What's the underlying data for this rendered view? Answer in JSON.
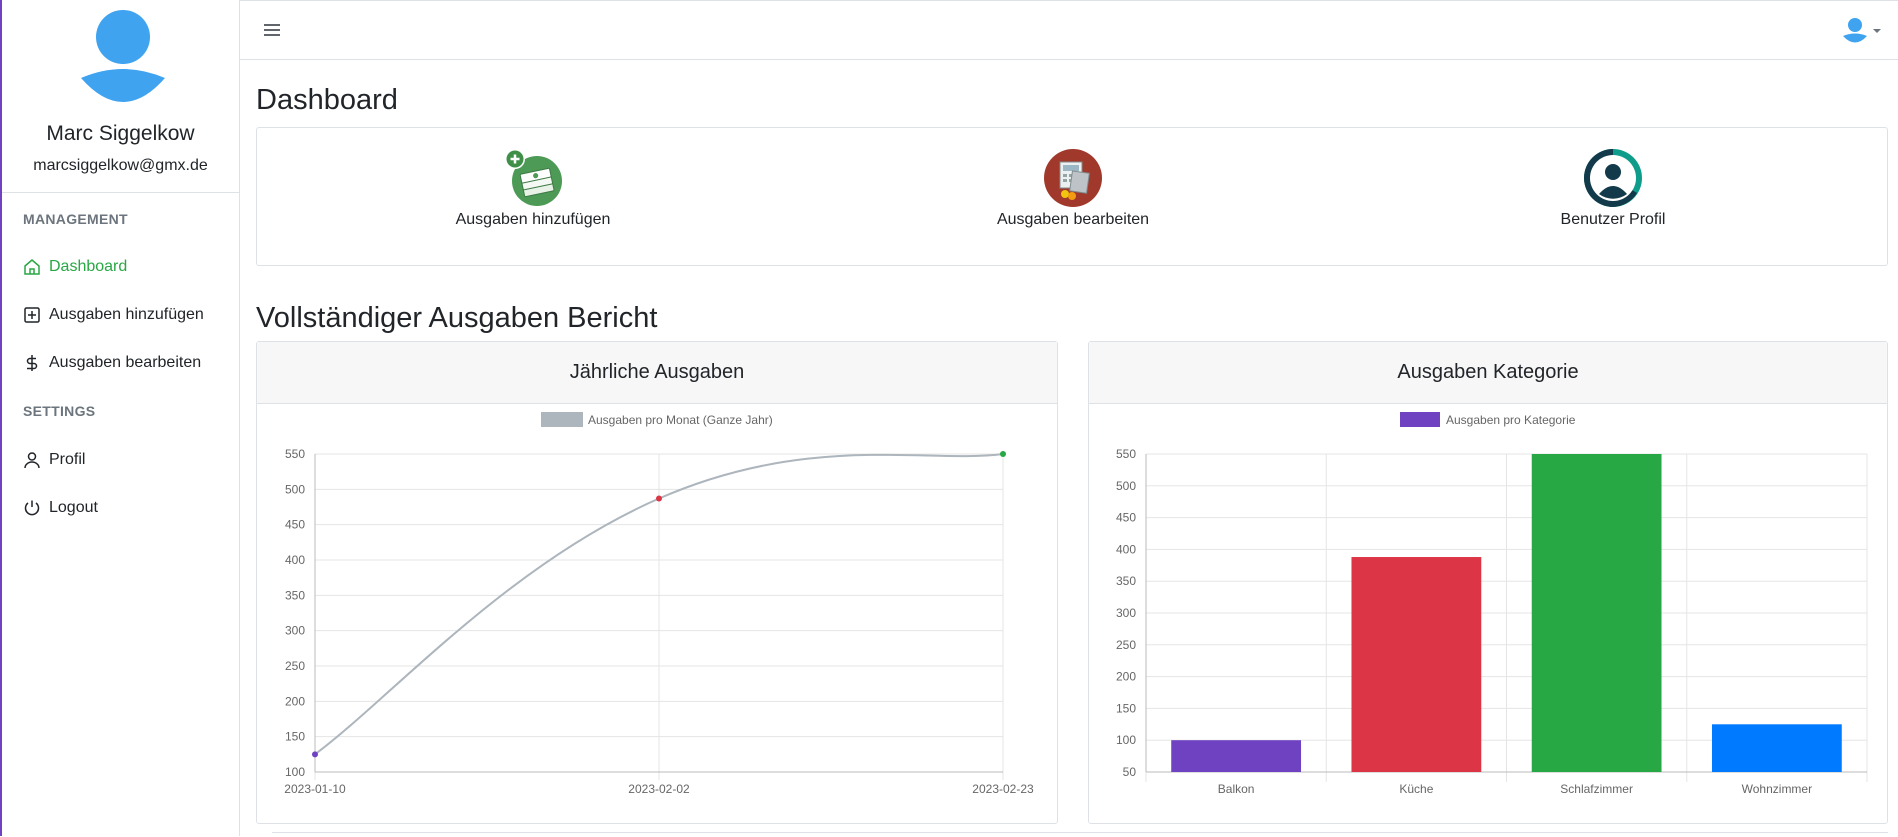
{
  "sidebar": {
    "user_name": "Marc Siggelkow",
    "user_email": "marcsiggelkow@gmx.de",
    "management_heading": "MANAGEMENT",
    "settings_heading": "SETTINGS",
    "items": [
      {
        "label": "Dashboard",
        "icon": "home-icon",
        "active": true
      },
      {
        "label": "Ausgaben hinzufügen",
        "icon": "plus-square-icon",
        "active": false
      },
      {
        "label": "Ausgaben bearbeiten",
        "icon": "dollar-icon",
        "active": false
      },
      {
        "label": "Profil",
        "icon": "user-icon",
        "active": false
      },
      {
        "label": "Logout",
        "icon": "power-icon",
        "active": false
      }
    ],
    "accent_color": "#28a745"
  },
  "header": {
    "menu_icon": "hamburger-icon",
    "user_icon": "user-avatar-icon"
  },
  "main": {
    "title": "Dashboard",
    "quick_links": [
      {
        "label": "Ausgaben hinzufügen",
        "icon": "add-money-icon"
      },
      {
        "label": "Ausgaben bearbeiten",
        "icon": "calculator-icon"
      },
      {
        "label": "Benutzer Profil",
        "icon": "user-profile-icon"
      }
    ],
    "report_title": "Vollständiger Ausgaben Bericht",
    "yearly_card_title": "Jährliche Ausgaben",
    "category_card_title": "Ausgaben Kategorie"
  },
  "chart_data": [
    {
      "type": "line",
      "legend": "Ausgaben pro Monat (Ganze Jahr)",
      "legend_color": "#adb5bd",
      "x": [
        "2023-01-10",
        "2023-02-02",
        "2023-02-23"
      ],
      "values": [
        125,
        487,
        550
      ],
      "point_colors": [
        "#6f42c1",
        "#dc3545",
        "#28a745"
      ],
      "yticks": [
        100,
        150,
        200,
        250,
        300,
        350,
        400,
        450,
        500,
        550
      ],
      "ylim": [
        100,
        550
      ],
      "grid": true,
      "legend_position": "top"
    },
    {
      "type": "bar",
      "legend": "Ausgaben pro Kategorie",
      "legend_color": "#6f42c1",
      "categories": [
        "Balkon",
        "Küche",
        "Schlafzimmer",
        "Wohnzimmer"
      ],
      "values": [
        100,
        388,
        550,
        125
      ],
      "colors": [
        "#6f42c1",
        "#dc3545",
        "#28a745",
        "#007bff"
      ],
      "yticks": [
        50,
        100,
        150,
        200,
        250,
        300,
        350,
        400,
        450,
        500,
        550
      ],
      "ylim": [
        50,
        550
      ],
      "grid": true,
      "legend_position": "top"
    }
  ]
}
